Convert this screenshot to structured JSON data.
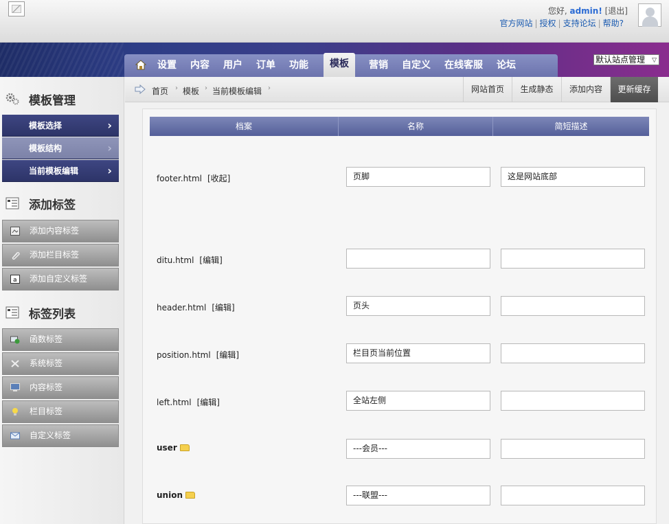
{
  "header": {
    "greeting": "您好,",
    "username": "admin!",
    "logout": "[退出]",
    "links": [
      "官方网站",
      "授权",
      "支持论坛",
      "帮助?"
    ]
  },
  "nav": {
    "items": [
      "设置",
      "内容",
      "用户",
      "订单",
      "功能",
      "模板",
      "营销",
      "自定义",
      "在线客服",
      "论坛"
    ],
    "active": "模板",
    "site_select": "默认站点管理"
  },
  "sidebar": {
    "template_heading": "模板管理",
    "template_items": [
      "模板选择",
      "模板结构",
      "当前模板编辑"
    ],
    "add_tag_heading": "添加标签",
    "add_tag_items": [
      "添加内容标签",
      "添加栏目标签",
      "添加自定义标签"
    ],
    "tag_list_heading": "标签列表",
    "tag_list_items": [
      "函数标签",
      "系统标签",
      "内容标签",
      "栏目标签",
      "自定义标签"
    ]
  },
  "breadcrumb": [
    "首页",
    "模板",
    "当前模板编辑"
  ],
  "actions": [
    "网站首页",
    "生成静态",
    "添加内容",
    "更新缓存"
  ],
  "table": {
    "headers": [
      "档案",
      "名称",
      "简短描述"
    ],
    "rows": [
      {
        "file": "footer.html",
        "action": "[收起]",
        "name": "页脚",
        "desc": "这是网站底部"
      },
      {
        "file": "ditu.html",
        "action": "[编辑]",
        "name": "",
        "desc": ""
      },
      {
        "file": "header.html",
        "action": "[编辑]",
        "name": "页头",
        "desc": ""
      },
      {
        "file": "position.html",
        "action": "[编辑]",
        "name": "栏目页当前位置",
        "desc": ""
      },
      {
        "file": "left.html",
        "action": "[编辑]",
        "name": "全站左侧",
        "desc": ""
      },
      {
        "file": "user",
        "action": "",
        "name": "---会员---",
        "desc": ""
      },
      {
        "file": "union",
        "action": "",
        "name": "---联盟---",
        "desc": ""
      }
    ]
  },
  "colors": {
    "nav_dark": "#2d3468",
    "table_header": "#6a73a8",
    "link_blue": "#1b5bb0"
  }
}
